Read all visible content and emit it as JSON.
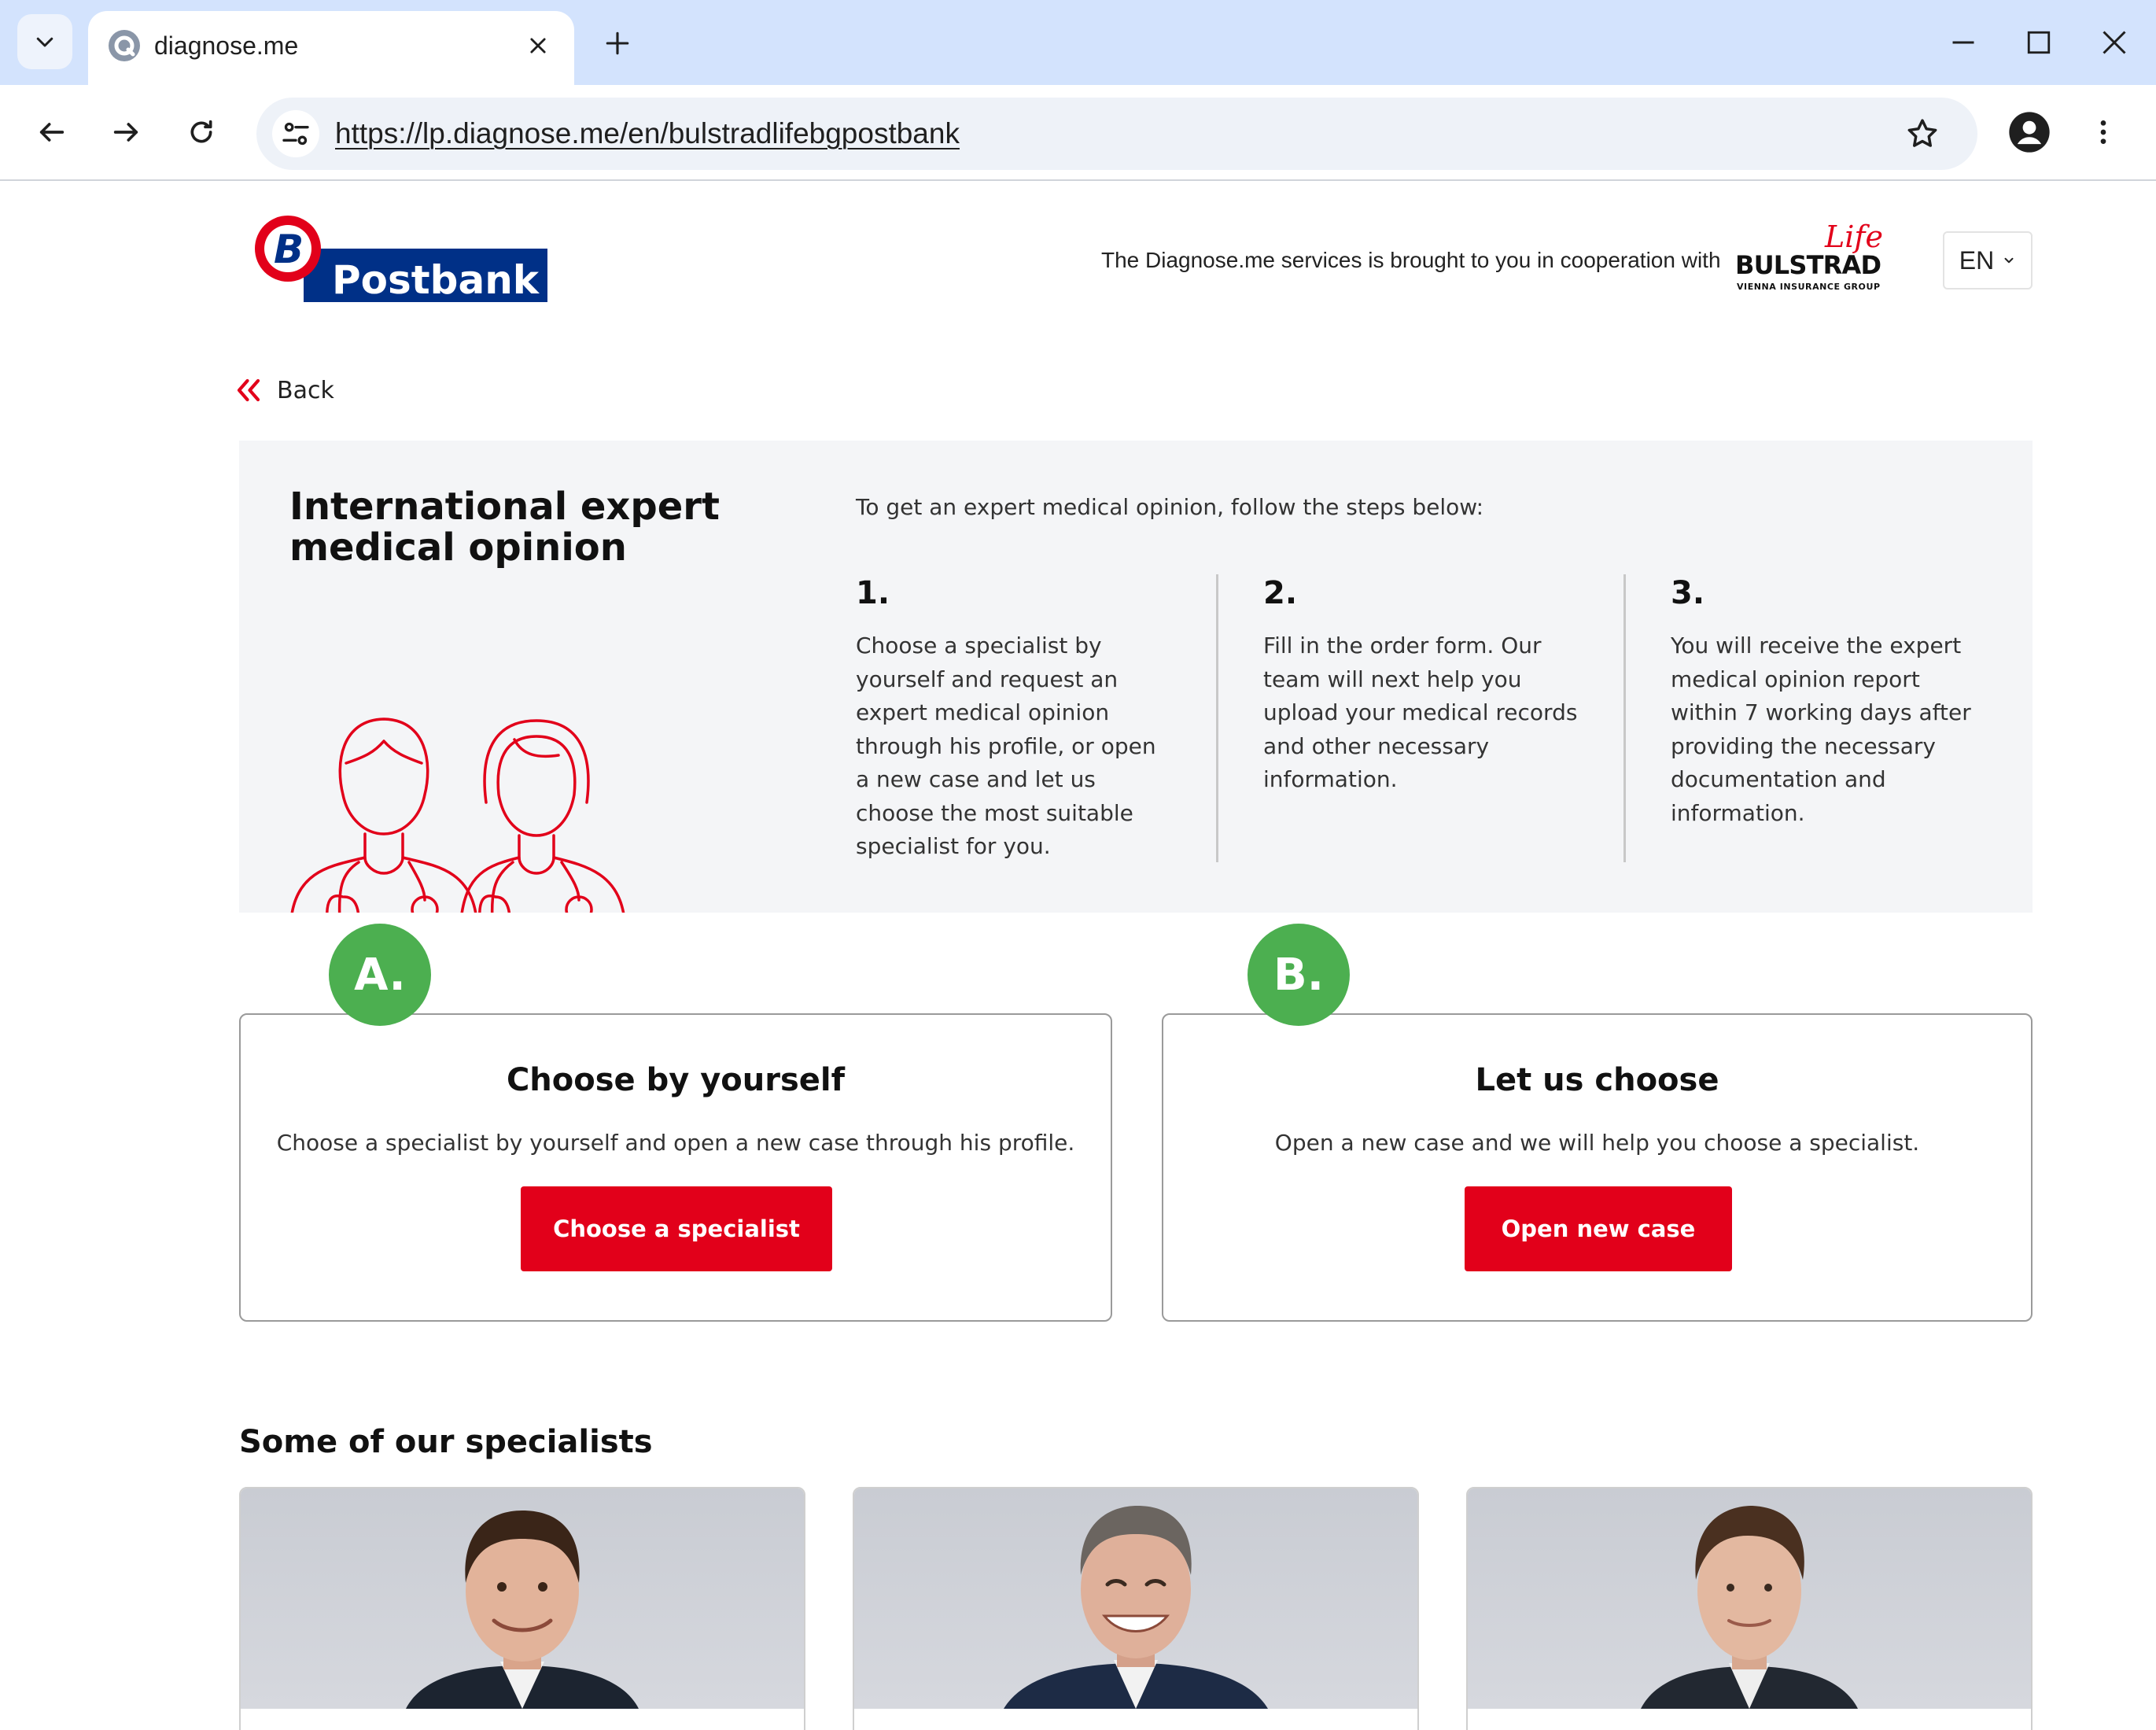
{
  "browser": {
    "tab_title": "diagnose.me",
    "url": "https://lp.diagnose.me/en/bulstradlifebgpostbank"
  },
  "header": {
    "postbank_logo_text": "Postbank",
    "cooperation_text": "The Diagnose.me services is brought to you in cooperation with",
    "bulstrad_logo": {
      "script": "Life",
      "name": "BULSTRAD",
      "tagline": "VIENNA INSURANCE GROUP"
    },
    "language": "EN"
  },
  "back_label": "Back",
  "hero": {
    "title": "International expert medical opinion",
    "intro": "To get an expert medical opinion, follow the steps below:",
    "steps": [
      {
        "number": "1.",
        "text": "Choose a specialist by yourself and request an expert medical opinion through his profile, or open a new case and let us choose the most suitable specialist for you."
      },
      {
        "number": "2.",
        "text": "Fill in the order form. Our team will next help you upload your medical records and other necessary information."
      },
      {
        "number": "3.",
        "text": "You will receive the expert medical opinion report within 7 working days after providing the necessary documentation and information."
      }
    ]
  },
  "options": [
    {
      "badge": "A.",
      "title": "Choose by yourself",
      "description": "Choose a specialist by yourself and open a new case through his profile.",
      "button": "Choose a specialist"
    },
    {
      "badge": "B.",
      "title": "Let us choose",
      "description": "Open a new case and we will help you choose a specialist.",
      "button": "Open new case"
    }
  ],
  "specialists_title": "Some of our specialists",
  "colors": {
    "accent_red": "#e2001a",
    "badge_green": "#4caf50",
    "postbank_blue": "#003087",
    "hero_bg": "#f4f5f7"
  },
  "icons": {
    "back": "double-chevron-left-icon",
    "lang_dropdown": "chevron-down-icon",
    "illustration": "doctors-icon"
  }
}
